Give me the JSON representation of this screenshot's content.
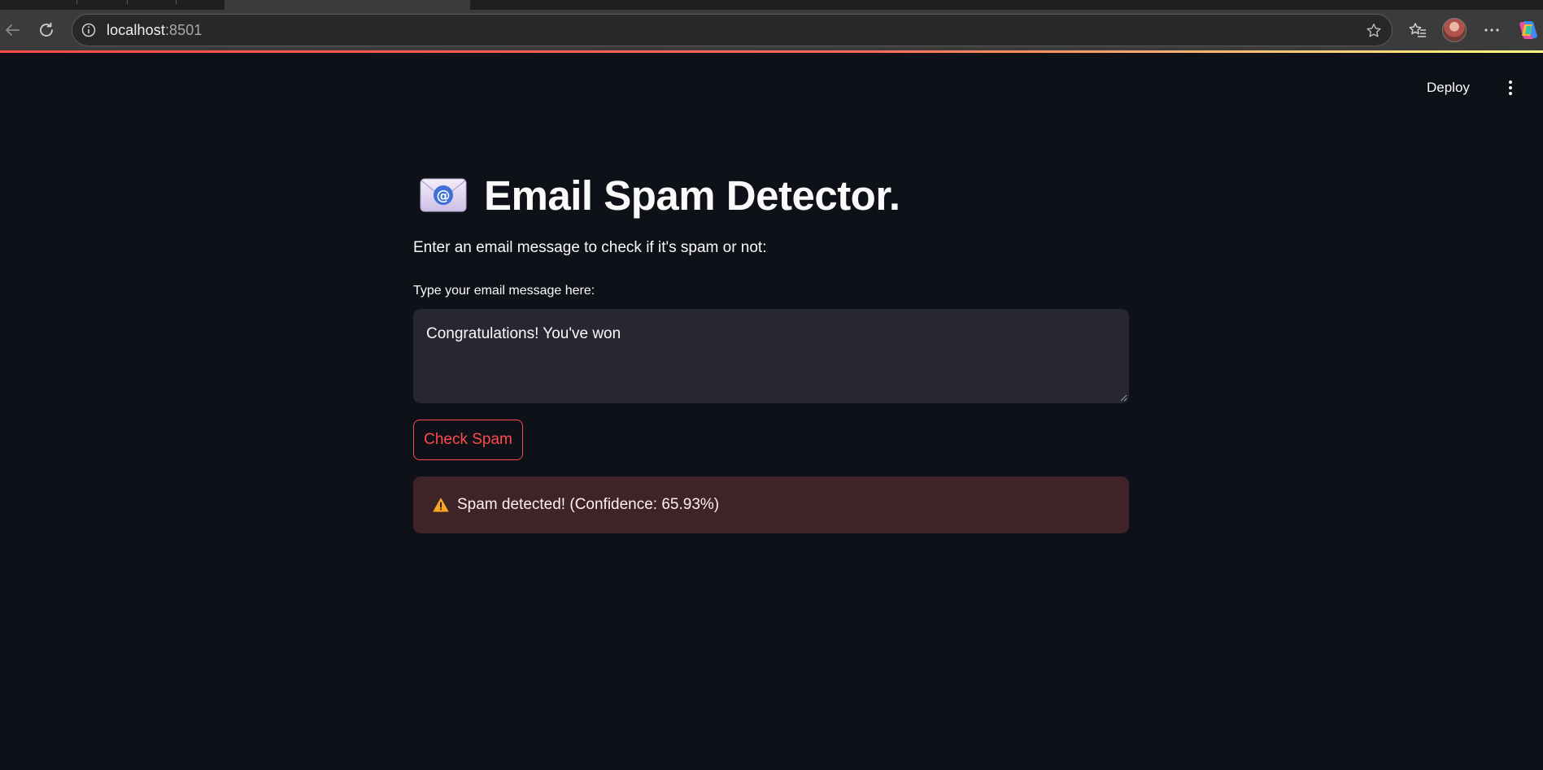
{
  "browser": {
    "url_host": "localhost",
    "url_port": ":8501"
  },
  "header": {
    "deploy_label": "Deploy"
  },
  "app": {
    "title": "Email Spam Detector.",
    "subtitle": "Enter an email message to check if it's spam or not:",
    "input_label": "Type your email message here:",
    "input_value": "Congratulations! You've won",
    "button_label": "Check Spam",
    "result_text": "Spam detected! (Confidence: 65.93%)"
  },
  "colors": {
    "background": "#0e1117",
    "accent": "#ff4b4b",
    "input_background": "#262730",
    "alert_background": "#3e2328"
  }
}
